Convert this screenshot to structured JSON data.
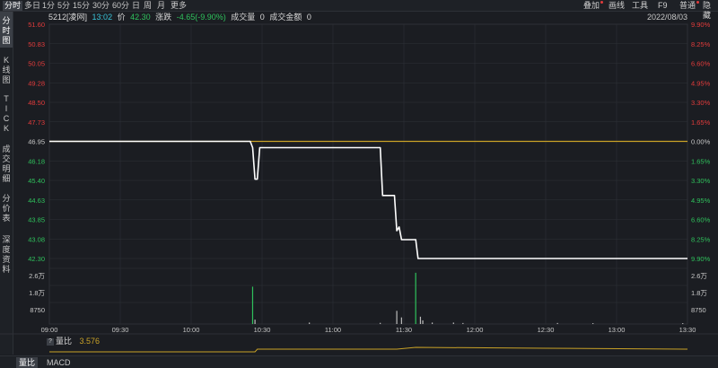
{
  "toolbar": {
    "tabs": [
      "分时",
      "多日",
      "1分",
      "5分",
      "15分",
      "30分",
      "60分",
      "日",
      "周",
      "月",
      "更多"
    ],
    "active_tab": "分时",
    "right": [
      "叠加",
      "画线",
      "工具",
      "F9",
      "普通",
      "隐藏"
    ]
  },
  "side_tabs": [
    "分时图",
    "K线图",
    "TICK",
    "成交明细",
    "分价表",
    "深度资料"
  ],
  "info": {
    "code": "5212[凌网]",
    "time": "13:02",
    "price_label": "价",
    "price": "42.30",
    "change_label": "涨跌",
    "change": "-4.65(-9.90%)",
    "volume_label": "成交量",
    "volume": "0",
    "amount_label": "成交金额",
    "amount": "0",
    "date": "2022/08/03"
  },
  "colors": {
    "background": "#1b1d22",
    "grid": "#2e3137",
    "price_line": "#ffffff",
    "reference_line": "#c9a227",
    "up": "#e23b3b",
    "down": "#2fc15c",
    "neutral": "#c8c8c8",
    "ratio_line": "#c9a227"
  },
  "chart_data": {
    "type": "line",
    "title": "",
    "reference_price": 46.95,
    "y_ticks_price": [
      "51.60",
      "50.83",
      "50.05",
      "49.28",
      "48.50",
      "47.73",
      "46.95",
      "46.18",
      "45.40",
      "44.63",
      "43.85",
      "43.08",
      "42.30"
    ],
    "y_ticks_pct": [
      "9.90%",
      "8.25%",
      "6.60%",
      "4.95%",
      "3.30%",
      "1.65%",
      "0.00%",
      "1.65%",
      "3.30%",
      "4.95%",
      "6.60%",
      "8.25%",
      "9.90%"
    ],
    "ylim": [
      42.3,
      51.6
    ],
    "x_ticks": [
      "09:00",
      "09:30",
      "10:00",
      "10:30",
      "11:00",
      "11:30",
      "12:00",
      "12:30",
      "13:00",
      "13:30"
    ],
    "x": [
      "09:00",
      "10:25",
      "10:26",
      "10:27",
      "10:28",
      "10:29",
      "11:20",
      "11:21",
      "11:26",
      "11:27",
      "11:28",
      "11:29",
      "11:31",
      "11:35",
      "11:36",
      "13:30"
    ],
    "series": [
      {
        "values": [
          46.95,
          46.95,
          46.7,
          45.45,
          45.45,
          46.7,
          46.7,
          44.8,
          44.8,
          43.4,
          43.55,
          43.05,
          43.05,
          43.05,
          42.3,
          42.3
        ]
      }
    ],
    "volume_ticks": [
      "2.6万",
      "1.8万",
      "8750"
    ],
    "volume_bars": [
      {
        "time": "10:26",
        "value": 25500
      },
      {
        "time": "10:27",
        "value": 3000
      },
      {
        "time": "10:50",
        "value": 1000
      },
      {
        "time": "11:20",
        "value": 800
      },
      {
        "time": "11:27",
        "value": 9000
      },
      {
        "time": "11:29",
        "value": 4500
      },
      {
        "time": "11:35",
        "value": 35000
      },
      {
        "time": "11:37",
        "value": 5000
      },
      {
        "time": "11:38",
        "value": 2500
      },
      {
        "time": "11:42",
        "value": 1000
      },
      {
        "time": "11:51",
        "value": 1000
      },
      {
        "time": "11:55",
        "value": 700
      },
      {
        "time": "12:35",
        "value": 700
      },
      {
        "time": "12:50",
        "value": 600
      },
      {
        "time": "13:28",
        "value": 600
      }
    ],
    "volume_ratio_label": "量比",
    "volume_ratio_value": "3.576"
  },
  "bottom_tabs": [
    "量比",
    "MACD"
  ],
  "active_bottom_tab": "量比"
}
